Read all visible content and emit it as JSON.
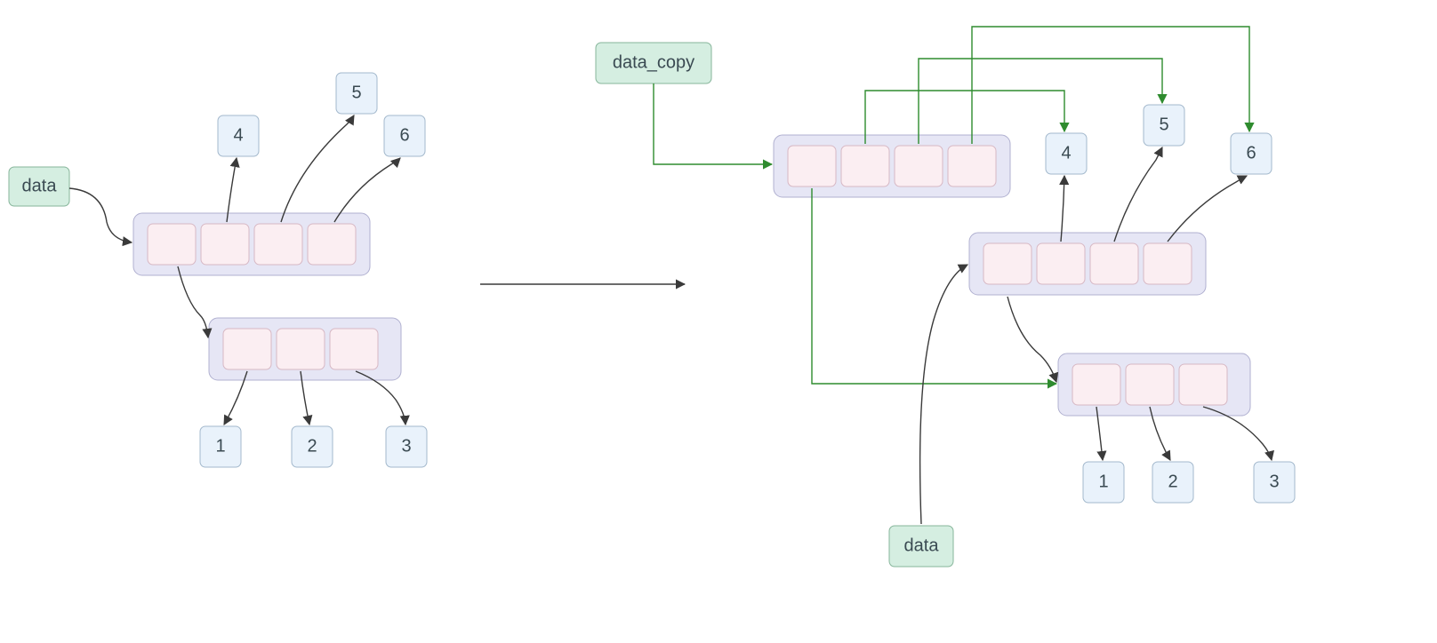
{
  "left": {
    "data_label": "data",
    "top_list_cells": 4,
    "sub_list_cells": 3,
    "nums": {
      "n1": "1",
      "n2": "2",
      "n3": "3",
      "n4": "4",
      "n5": "5",
      "n6": "6"
    }
  },
  "right": {
    "data_copy_label": "data_copy",
    "data_label": "data",
    "top_list_cells": 4,
    "mid_list_cells": 4,
    "sub_list_cells": 3,
    "nums": {
      "n1": "1",
      "n2": "2",
      "n3": "3",
      "n4": "4",
      "n5": "5",
      "n6": "6"
    }
  }
}
